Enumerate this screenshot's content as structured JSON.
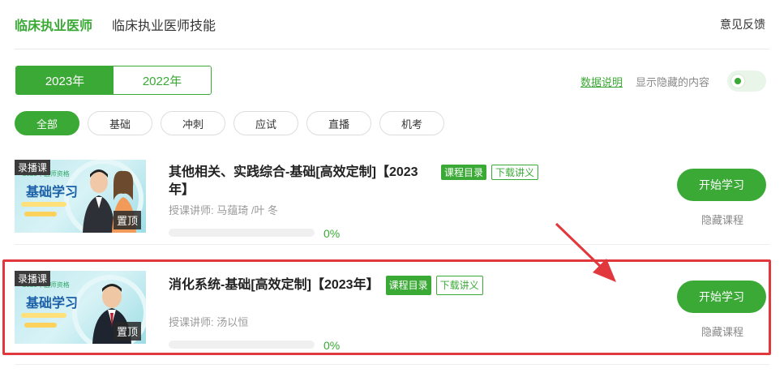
{
  "top_tabs": [
    "临床执业医师",
    "临床执业医师技能"
  ],
  "feedback_label": "意见反馈",
  "years": [
    "2023年",
    "2022年"
  ],
  "data_note": "数据说明",
  "show_hidden_label": "显示隐藏的内容",
  "filters": [
    "全部",
    "基础",
    "冲刺",
    "应试",
    "直播",
    "机考"
  ],
  "thumb": {
    "record_tag": "录播课",
    "pin_tag": "置顶",
    "poster_sub": "2023年医师资格",
    "poster_title": "基础学习"
  },
  "courses": [
    {
      "title_line1": "其他相关、实践综合-基础[高效定制]【2023",
      "title_line2": "年】",
      "catalog": "课程目录",
      "download": "下载讲义",
      "teacher": "授课讲师:  马蕴琦 /叶    冬",
      "progress": 0,
      "progress_text": "0%",
      "start": "开始学习",
      "hide": "隐藏课程"
    },
    {
      "title_line1": "消化系统-基础[高效定制]【2023年】",
      "catalog": "课程目录",
      "download": "下载讲义",
      "teacher": "授课讲师:  汤以恒",
      "progress": 0,
      "progress_text": "0%",
      "start": "开始学习",
      "hide": "隐藏课程"
    }
  ],
  "colors": {
    "accent": "#3aa935",
    "highlight": "#e0383d"
  }
}
